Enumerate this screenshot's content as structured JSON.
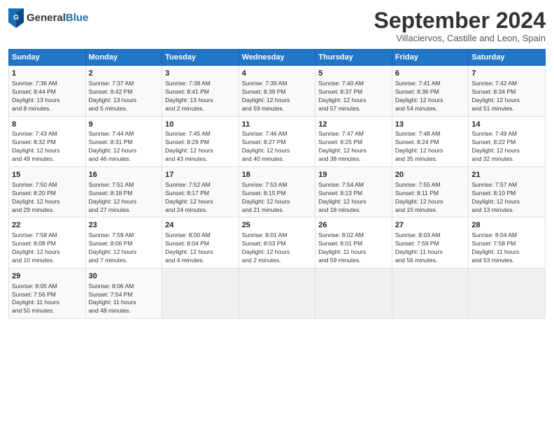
{
  "header": {
    "logo_general": "General",
    "logo_blue": "Blue",
    "title": "September 2024",
    "subtitle": "Villaciervos, Castille and Leon, Spain"
  },
  "days_of_week": [
    "Sunday",
    "Monday",
    "Tuesday",
    "Wednesday",
    "Thursday",
    "Friday",
    "Saturday"
  ],
  "weeks": [
    [
      {
        "num": "1",
        "info": "Sunrise: 7:36 AM\nSunset: 8:44 PM\nDaylight: 13 hours\nand 8 minutes."
      },
      {
        "num": "2",
        "info": "Sunrise: 7:37 AM\nSunset: 8:42 PM\nDaylight: 13 hours\nand 5 minutes."
      },
      {
        "num": "3",
        "info": "Sunrise: 7:38 AM\nSunset: 8:41 PM\nDaylight: 13 hours\nand 2 minutes."
      },
      {
        "num": "4",
        "info": "Sunrise: 7:39 AM\nSunset: 8:39 PM\nDaylight: 12 hours\nand 59 minutes."
      },
      {
        "num": "5",
        "info": "Sunrise: 7:40 AM\nSunset: 8:37 PM\nDaylight: 12 hours\nand 57 minutes."
      },
      {
        "num": "6",
        "info": "Sunrise: 7:41 AM\nSunset: 8:36 PM\nDaylight: 12 hours\nand 54 minutes."
      },
      {
        "num": "7",
        "info": "Sunrise: 7:42 AM\nSunset: 8:34 PM\nDaylight: 12 hours\nand 51 minutes."
      }
    ],
    [
      {
        "num": "8",
        "info": "Sunrise: 7:43 AM\nSunset: 8:32 PM\nDaylight: 12 hours\nand 49 minutes."
      },
      {
        "num": "9",
        "info": "Sunrise: 7:44 AM\nSunset: 8:31 PM\nDaylight: 12 hours\nand 46 minutes."
      },
      {
        "num": "10",
        "info": "Sunrise: 7:45 AM\nSunset: 8:29 PM\nDaylight: 12 hours\nand 43 minutes."
      },
      {
        "num": "11",
        "info": "Sunrise: 7:46 AM\nSunset: 8:27 PM\nDaylight: 12 hours\nand 40 minutes."
      },
      {
        "num": "12",
        "info": "Sunrise: 7:47 AM\nSunset: 8:25 PM\nDaylight: 12 hours\nand 38 minutes."
      },
      {
        "num": "13",
        "info": "Sunrise: 7:48 AM\nSunset: 8:24 PM\nDaylight: 12 hours\nand 35 minutes."
      },
      {
        "num": "14",
        "info": "Sunrise: 7:49 AM\nSunset: 8:22 PM\nDaylight: 12 hours\nand 32 minutes."
      }
    ],
    [
      {
        "num": "15",
        "info": "Sunrise: 7:50 AM\nSunset: 8:20 PM\nDaylight: 12 hours\nand 29 minutes."
      },
      {
        "num": "16",
        "info": "Sunrise: 7:51 AM\nSunset: 8:18 PM\nDaylight: 12 hours\nand 27 minutes."
      },
      {
        "num": "17",
        "info": "Sunrise: 7:52 AM\nSunset: 8:17 PM\nDaylight: 12 hours\nand 24 minutes."
      },
      {
        "num": "18",
        "info": "Sunrise: 7:53 AM\nSunset: 8:15 PM\nDaylight: 12 hours\nand 21 minutes."
      },
      {
        "num": "19",
        "info": "Sunrise: 7:54 AM\nSunset: 8:13 PM\nDaylight: 12 hours\nand 18 minutes."
      },
      {
        "num": "20",
        "info": "Sunrise: 7:55 AM\nSunset: 8:11 PM\nDaylight: 12 hours\nand 15 minutes."
      },
      {
        "num": "21",
        "info": "Sunrise: 7:57 AM\nSunset: 8:10 PM\nDaylight: 12 hours\nand 13 minutes."
      }
    ],
    [
      {
        "num": "22",
        "info": "Sunrise: 7:58 AM\nSunset: 8:08 PM\nDaylight: 12 hours\nand 10 minutes."
      },
      {
        "num": "23",
        "info": "Sunrise: 7:59 AM\nSunset: 8:06 PM\nDaylight: 12 hours\nand 7 minutes."
      },
      {
        "num": "24",
        "info": "Sunrise: 8:00 AM\nSunset: 8:04 PM\nDaylight: 12 hours\nand 4 minutes."
      },
      {
        "num": "25",
        "info": "Sunrise: 8:01 AM\nSunset: 8:03 PM\nDaylight: 12 hours\nand 2 minutes."
      },
      {
        "num": "26",
        "info": "Sunrise: 8:02 AM\nSunset: 8:01 PM\nDaylight: 11 hours\nand 59 minutes."
      },
      {
        "num": "27",
        "info": "Sunrise: 8:03 AM\nSunset: 7:59 PM\nDaylight: 11 hours\nand 56 minutes."
      },
      {
        "num": "28",
        "info": "Sunrise: 8:04 AM\nSunset: 7:58 PM\nDaylight: 11 hours\nand 53 minutes."
      }
    ],
    [
      {
        "num": "29",
        "info": "Sunrise: 8:05 AM\nSunset: 7:56 PM\nDaylight: 11 hours\nand 50 minutes."
      },
      {
        "num": "30",
        "info": "Sunrise: 8:06 AM\nSunset: 7:54 PM\nDaylight: 11 hours\nand 48 minutes."
      },
      {
        "num": "",
        "info": ""
      },
      {
        "num": "",
        "info": ""
      },
      {
        "num": "",
        "info": ""
      },
      {
        "num": "",
        "info": ""
      },
      {
        "num": "",
        "info": ""
      }
    ]
  ]
}
